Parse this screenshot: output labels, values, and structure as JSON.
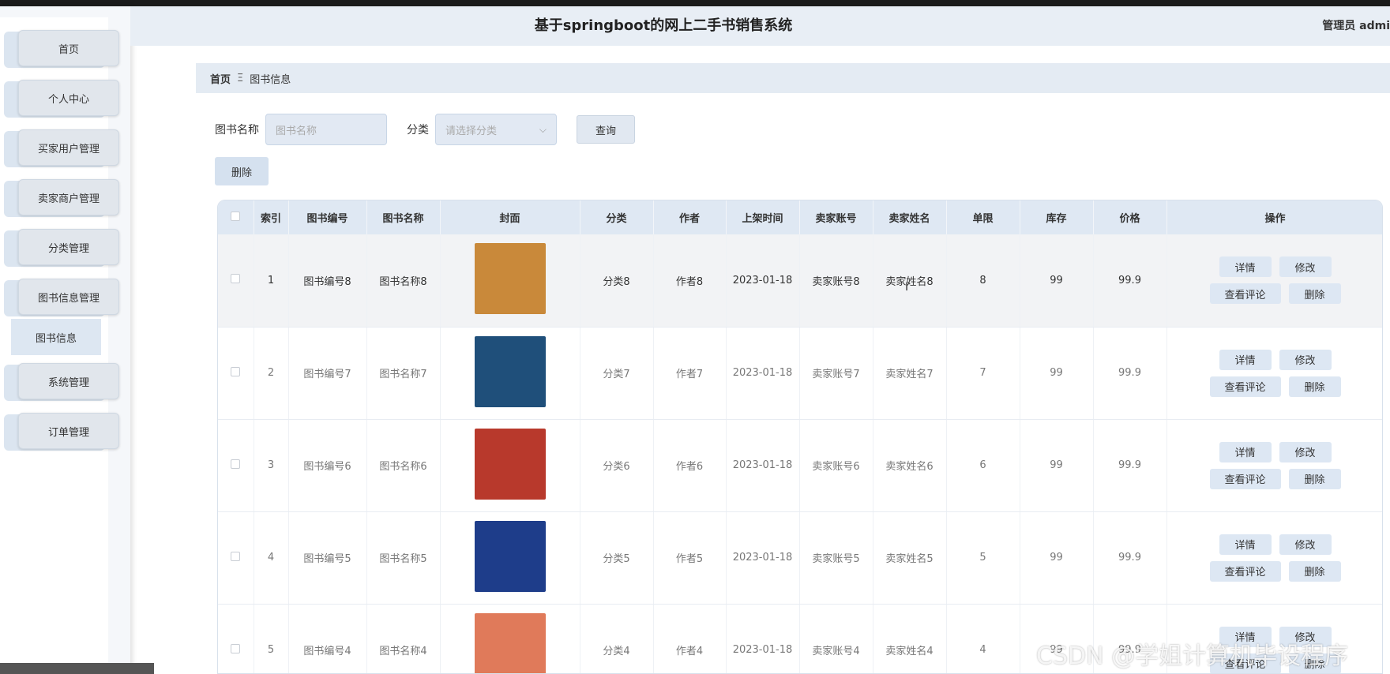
{
  "app": {
    "title": "基于springboot的网上二手书销售系统",
    "user": "管理员 admi"
  },
  "sidebar": {
    "items": [
      {
        "label": "首页"
      },
      {
        "label": "个人中心"
      },
      {
        "label": "买家用户管理"
      },
      {
        "label": "卖家商户管理"
      },
      {
        "label": "分类管理"
      },
      {
        "label": "图书信息管理"
      },
      {
        "label": "系统管理"
      },
      {
        "label": "订单管理"
      }
    ],
    "submenu_label": "图书信息"
  },
  "breadcrumb": {
    "home": "首页",
    "separator": "Ξ",
    "current": "图书信息"
  },
  "search": {
    "name_label": "图书名称",
    "name_placeholder": "图书名称",
    "category_label": "分类",
    "category_placeholder": "请选择分类",
    "query_button": "查询"
  },
  "toolbar": {
    "delete_button": "删除"
  },
  "table": {
    "headers": [
      "",
      "索引",
      "图书编号",
      "图书名称",
      "封面",
      "分类",
      "作者",
      "上架时间",
      "卖家账号",
      "卖家姓名",
      "单限",
      "库存",
      "价格",
      "操作"
    ],
    "rows": [
      {
        "index": "1",
        "book_no": "图书编号8",
        "book_name": "图书名称8",
        "category": "分类8",
        "author": "作者8",
        "date": "2023-01-18",
        "seller_account": "卖家账号8",
        "seller_name": "卖家姓名8",
        "limit": "8",
        "stock": "99",
        "price": "99.9",
        "cover_color": "#c9893a"
      },
      {
        "index": "2",
        "book_no": "图书编号7",
        "book_name": "图书名称7",
        "category": "分类7",
        "author": "作者7",
        "date": "2023-01-18",
        "seller_account": "卖家账号7",
        "seller_name": "卖家姓名7",
        "limit": "7",
        "stock": "99",
        "price": "99.9",
        "cover_color": "#1f4f7a"
      },
      {
        "index": "3",
        "book_no": "图书编号6",
        "book_name": "图书名称6",
        "category": "分类6",
        "author": "作者6",
        "date": "2023-01-18",
        "seller_account": "卖家账号6",
        "seller_name": "卖家姓名6",
        "limit": "6",
        "stock": "99",
        "price": "99.9",
        "cover_color": "#b8392c"
      },
      {
        "index": "4",
        "book_no": "图书编号5",
        "book_name": "图书名称5",
        "category": "分类5",
        "author": "作者5",
        "date": "2023-01-18",
        "seller_account": "卖家账号5",
        "seller_name": "卖家姓名5",
        "limit": "5",
        "stock": "99",
        "price": "99.9",
        "cover_color": "#1e3d8a"
      },
      {
        "index": "5",
        "book_no": "图书编号4",
        "book_name": "图书名称4",
        "category": "分类4",
        "author": "作者4",
        "date": "2023-01-18",
        "seller_account": "卖家账号4",
        "seller_name": "卖家姓名4",
        "limit": "4",
        "stock": "99",
        "price": "99.9",
        "cover_color": "#e07a5a"
      }
    ],
    "actions": {
      "detail": "详情",
      "edit": "修改",
      "comments": "查看评论",
      "delete": "删除"
    }
  },
  "watermark": "CSDN @学姐计算机毕设程序"
}
